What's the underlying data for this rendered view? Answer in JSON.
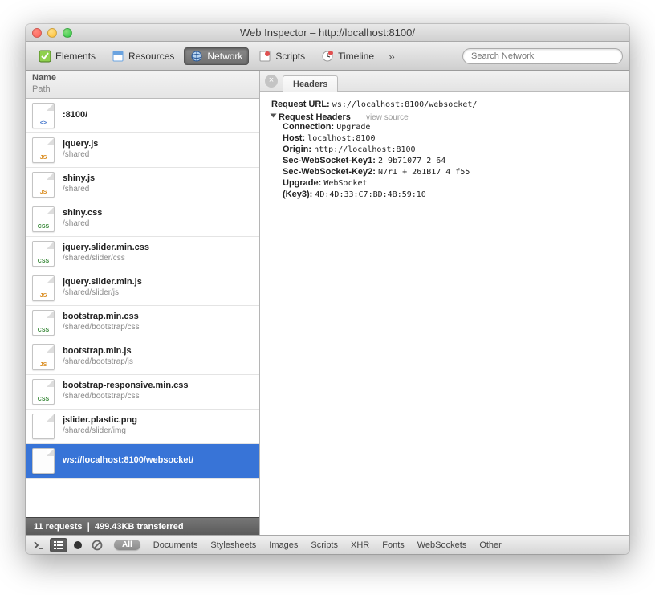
{
  "window": {
    "title": "Web Inspector – http://localhost:8100/"
  },
  "toolbar": {
    "elements": "Elements",
    "resources": "Resources",
    "network": "Network",
    "scripts": "Scripts",
    "timeline": "Timeline",
    "more": "»",
    "search_placeholder": "Search Network"
  },
  "sidebar": {
    "head_name": "Name",
    "head_path": "Path",
    "rows": [
      {
        "name": ":8100/",
        "path": "",
        "type": "html"
      },
      {
        "name": "jquery.js",
        "path": "/shared",
        "type": "js"
      },
      {
        "name": "shiny.js",
        "path": "/shared",
        "type": "js"
      },
      {
        "name": "shiny.css",
        "path": "/shared",
        "type": "css"
      },
      {
        "name": "jquery.slider.min.css",
        "path": "/shared/slider/css",
        "type": "css"
      },
      {
        "name": "jquery.slider.min.js",
        "path": "/shared/slider/js",
        "type": "js"
      },
      {
        "name": "bootstrap.min.css",
        "path": "/shared/bootstrap/css",
        "type": "css"
      },
      {
        "name": "bootstrap.min.js",
        "path": "/shared/bootstrap/js",
        "type": "js"
      },
      {
        "name": "bootstrap-responsive.min.css",
        "path": "/shared/bootstrap/css",
        "type": "css"
      },
      {
        "name": "jslider.plastic.png",
        "path": "/shared/slider/img",
        "type": "img"
      },
      {
        "name": "ws://localhost:8100/websocket/",
        "path": "",
        "type": "blank",
        "selected": true
      }
    ]
  },
  "main": {
    "tab": "Headers",
    "request_url_label": "Request URL:",
    "request_url": "ws://localhost:8100/websocket/",
    "section": "Request Headers",
    "view_source": "view source",
    "headers": [
      {
        "k": "Connection:",
        "v": "Upgrade"
      },
      {
        "k": "Host:",
        "v": "localhost:8100"
      },
      {
        "k": "Origin:",
        "v": "http://localhost:8100"
      },
      {
        "k": "Sec-WebSocket-Key1:",
        "v": "2        9b71077 2 64"
      },
      {
        "k": "Sec-WebSocket-Key2:",
        "v": "N7rI +   261B17 4 f55"
      },
      {
        "k": "Upgrade:",
        "v": "WebSocket"
      },
      {
        "k": "(Key3):",
        "v": "4D:4D:33:C7:BD:4B:59:10"
      }
    ]
  },
  "status": {
    "text": "11 requests  ❘  499.43KB transferred"
  },
  "bottom": {
    "all": "All",
    "filters": [
      "Documents",
      "Stylesheets",
      "Images",
      "Scripts",
      "XHR",
      "Fonts",
      "WebSockets",
      "Other"
    ]
  },
  "icon_labels": {
    "js": "JS",
    "css": "CSS",
    "html": "<>",
    "img": "",
    "blank": ""
  }
}
